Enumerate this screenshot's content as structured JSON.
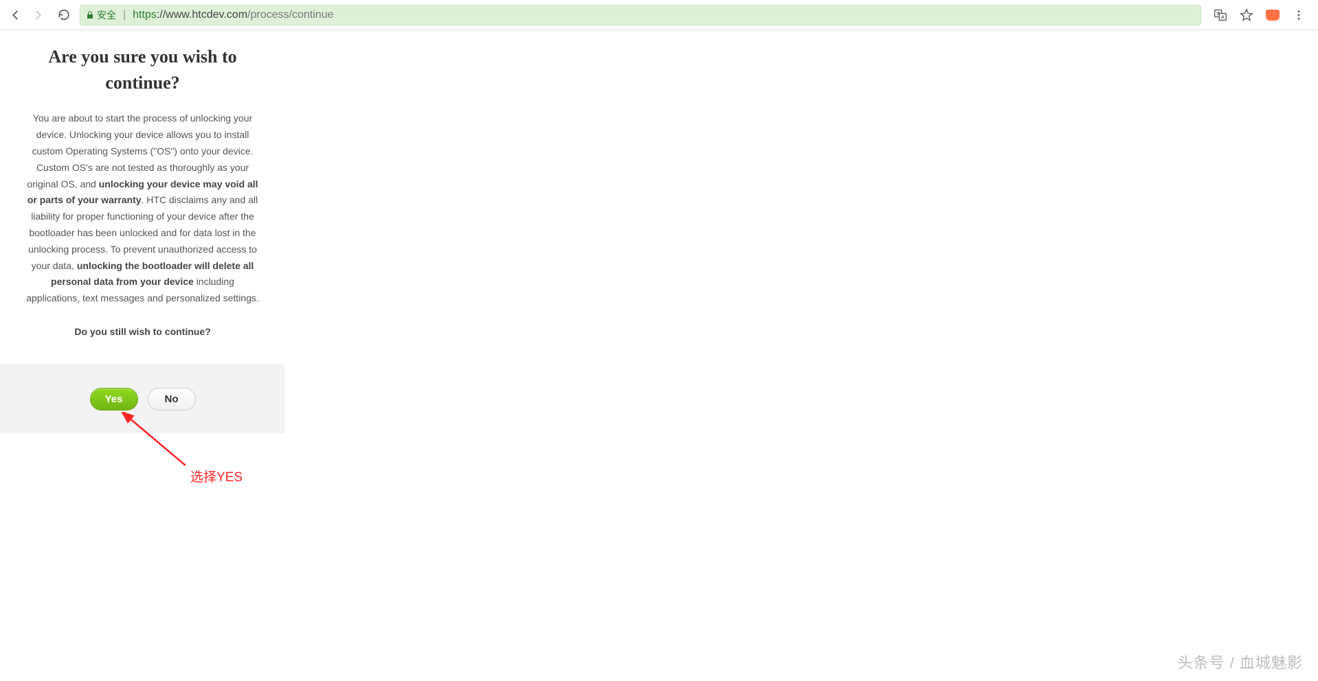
{
  "browser": {
    "secure_label": "安全",
    "url_scheme": "https",
    "url_domain": "://www.htcdev.com",
    "url_path": "/process/continue"
  },
  "dialog": {
    "title": "Are you sure you wish to continue?",
    "body_part1": "You are about to start the process of unlocking your device. Unlocking your device allows you to install custom Operating Systems (\"OS\") onto your device. Custom OS's are not tested as thoroughly as your original OS, and ",
    "bold1": "unlocking your device may void all or parts of your warranty",
    "body_part2": ". HTC disclaims any and all liability for proper functioning of your device after the bootloader has been unlocked and for data lost in the unlocking process. To prevent unauthorized access to your data, ",
    "bold2": "unlocking the bootloader will delete all personal data from your device",
    "body_part3": " including applications, text messages and personalized settings.",
    "confirm_text": "Do you still wish to continue?",
    "yes_label": "Yes",
    "no_label": "No"
  },
  "annotation": {
    "label": "选择YES"
  },
  "watermark": {
    "text": "头条号 / 血城魅影"
  }
}
